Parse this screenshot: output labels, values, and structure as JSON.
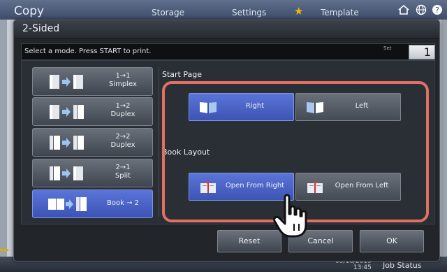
{
  "background": {
    "title": "Copy",
    "tabs": [
      "Storage",
      "Settings",
      "Template"
    ],
    "star_icon": "star-icon",
    "home_icon": "home-icon",
    "globe_icon": "globe-icon",
    "help_icon": "help-icon",
    "date": "05/16/2019",
    "time": "13:45",
    "job_status_label": "Job Status"
  },
  "dialog": {
    "title": "2-Sided",
    "instruction": "Select a mode. Press START to print.",
    "set_label": "Set",
    "set_value": "1"
  },
  "modes": [
    {
      "label": "1→1\nSimplex",
      "icon": "simplex-to-simplex-icon",
      "selected": false
    },
    {
      "label": "1→2\nDuplex",
      "icon": "simplex-to-duplex-icon",
      "selected": false
    },
    {
      "label": "2→2\nDuplex",
      "icon": "duplex-to-duplex-icon",
      "selected": false
    },
    {
      "label": "2→1\nSplit",
      "icon": "duplex-split-icon",
      "selected": false
    },
    {
      "label": "Book → 2",
      "icon": "book-to-duplex-icon",
      "selected": true
    }
  ],
  "start_page": {
    "label": "Start Page",
    "options": [
      {
        "label": "Right",
        "icon": "book-right-icon",
        "selected": true
      },
      {
        "label": "Left",
        "icon": "book-left-icon",
        "selected": false
      }
    ]
  },
  "book_layout": {
    "label": "Book Layout",
    "options": [
      {
        "label": "Open From Right",
        "icon": "open-from-right-icon",
        "selected": true
      },
      {
        "label": "Open From Left",
        "icon": "open-from-left-icon",
        "selected": false
      }
    ]
  },
  "footer": {
    "reset_label": "Reset",
    "cancel_label": "Cancel",
    "ok_label": "OK"
  },
  "colors": {
    "accent_selected": "#4d66cc",
    "highlight_border": "#e07062"
  },
  "cursor_icon": "hand-pointer-icon"
}
